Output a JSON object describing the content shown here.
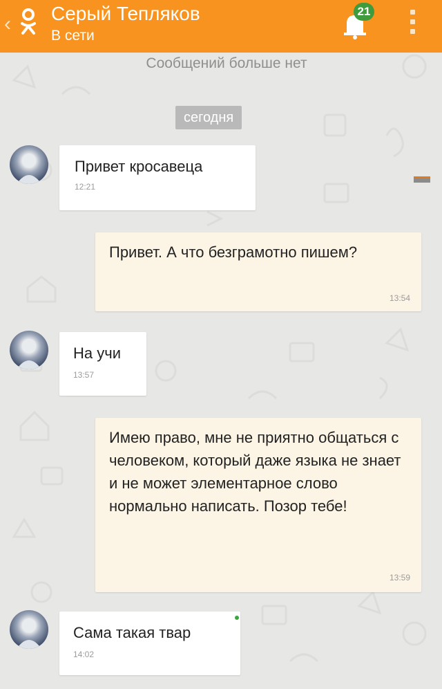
{
  "header": {
    "back_icon": "chevron-left-icon",
    "logo_icon": "odnoklassniki-logo-icon",
    "contact_name": "Серый Тепляков",
    "status": "В сети",
    "notifications_icon": "bell-icon",
    "notifications_count": "21",
    "menu_icon": "vertical-dots-icon",
    "accent_color": "#f7931e"
  },
  "chat": {
    "no_more_messages": "Сообщений больше нет",
    "date_separator": "сегодня",
    "messages": [
      {
        "from": "contact",
        "text": "Привет кросавеца",
        "time": "12:21"
      },
      {
        "from": "me",
        "text": "Привет. А что безграмотно пишем?",
        "time": "13:54"
      },
      {
        "from": "contact",
        "text": "На учи",
        "time": "13:57"
      },
      {
        "from": "me",
        "text": "Имею право, мне не приятно общаться с человеком, который даже языка не знает и не может элементарное слово нормально написать. Позор тебе!",
        "time": "13:59"
      },
      {
        "from": "contact",
        "text": "Сама такая твар",
        "time": "14:02"
      }
    ]
  }
}
